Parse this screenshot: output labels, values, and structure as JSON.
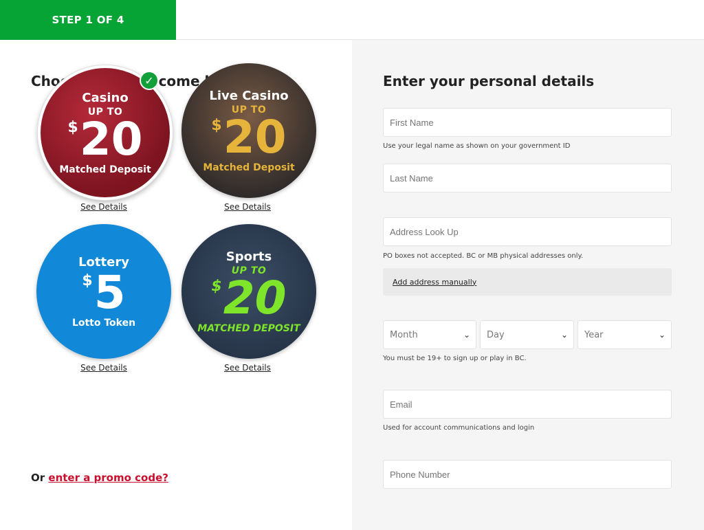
{
  "header": {
    "step": "STEP 1 OF 4"
  },
  "left": {
    "title": "Choose your welcome bonus!",
    "bonuses": [
      {
        "name": "Casino",
        "upto": "UP TO",
        "currency": "$",
        "amount": "20",
        "sub": "Matched Deposit",
        "details": "See Details",
        "selected": true
      },
      {
        "name": "Live Casino",
        "upto": "UP TO",
        "currency": "$",
        "amount": "20",
        "sub": "Matched Deposit",
        "details": "See Details",
        "selected": false
      },
      {
        "name": "Lottery",
        "upto": "",
        "currency": "$",
        "amount": "5",
        "sub": "Lotto Token",
        "details": "See Details",
        "selected": false
      },
      {
        "name": "Sports",
        "upto": "UP TO",
        "currency": "$",
        "amount": "20",
        "sub": "MATCHED DEPOSIT",
        "details": "See Details",
        "selected": false
      }
    ],
    "promo_prefix": "Or",
    "promo_link": "enter a promo code?"
  },
  "right": {
    "title": "Enter your personal details",
    "first_name_placeholder": "First Name",
    "first_name_hint": "Use your legal name as shown on your government ID",
    "last_name_placeholder": "Last Name",
    "address_placeholder": "Address Look Up",
    "address_hint": "PO boxes not accepted. BC or MB physical addresses only.",
    "manual_address": "Add address manually",
    "dob": {
      "month": "Month",
      "day": "Day",
      "year": "Year"
    },
    "dob_hint": "You must be 19+ to sign up or play in BC.",
    "email_placeholder": "Email",
    "email_hint": "Used for account communications and login",
    "phone_placeholder": "Phone Number"
  },
  "colors": {
    "brand_green": "#06a335",
    "promo_red": "#c8102e",
    "lottery_blue": "#1189d8",
    "sports_green": "#7ee52b"
  }
}
